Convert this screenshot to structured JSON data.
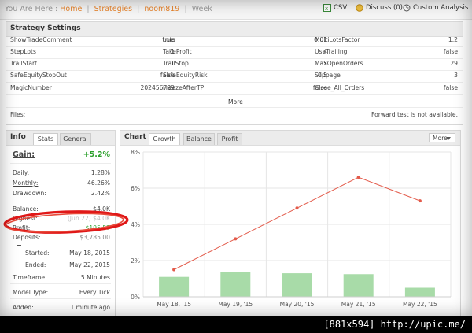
{
  "breadcrumb": {
    "prefix": "You Are Here :",
    "home": "Home",
    "strategies": "Strategies",
    "user": "noom819",
    "current": "Week"
  },
  "toolbar": {
    "csv": "CSV",
    "discuss": "Discuss (0)",
    "custom_analysis": "Custom Analysis"
  },
  "settings": {
    "title": "Strategy Settings",
    "rows": [
      [
        {
          "label": "ShowTradeComment",
          "value": "true"
        },
        {
          "label": "Lots",
          "value": "0.01"
        },
        {
          "label": "MultiLotsFactor",
          "value": "1.2"
        }
      ],
      [
        {
          "label": "StepLots",
          "value": "1"
        },
        {
          "label": "TakeProfit",
          "value": "4"
        },
        {
          "label": "UseTrailing",
          "value": "false"
        }
      ],
      [
        {
          "label": "TrailStart",
          "value": "1"
        },
        {
          "label": "TrailStop",
          "value": "5"
        },
        {
          "label": "MaxOpenOrders",
          "value": "29"
        }
      ],
      [
        {
          "label": "SafeEquityStopOut",
          "value": "false"
        },
        {
          "label": "SafeEquityRisk",
          "value": "0.5"
        },
        {
          "label": "Slippage",
          "value": "3"
        }
      ],
      [
        {
          "label": "MagicNumber",
          "value": "202456789"
        },
        {
          "label": "FreezeAfterTP",
          "value": "false"
        },
        {
          "label": "Close_All_Orders",
          "value": "false"
        }
      ]
    ],
    "more": "More",
    "files_label": "Files:",
    "files_note": "Forward test is not available."
  },
  "info": {
    "title": "Info",
    "tabs": [
      "Stats",
      "General"
    ],
    "gain_label": "Gain:",
    "gain_value": "+5.2%",
    "daily_label": "Daily:",
    "daily": "1.28%",
    "monthly_label": "Monthly:",
    "monthly": "46.26%",
    "drawdown_label": "Drawdown:",
    "drawdown": "2.42%",
    "balance_label": "Balance:",
    "balance": "$4.0K",
    "highest_label": "Highest:",
    "highest": "(Jun 22) $4.0K",
    "profit_label": "Profit:",
    "profit": "$195.57",
    "deposits_label": "Deposits:",
    "deposits": "$3,785.00",
    "started_label": "Started:",
    "started": "May 18, 2015",
    "ended_label": "Ended:",
    "ended": "May 22, 2015",
    "timeframe_label": "Timeframe:",
    "timeframe": "5 Minutes",
    "model_label": "Model Type:",
    "model": "Every Tick",
    "added_label": "Added:",
    "added": "1 minute ago"
  },
  "chart_panel": {
    "title": "Chart",
    "tabs": [
      "Growth",
      "Balance",
      "Profit"
    ],
    "more": "More"
  },
  "chart_data": {
    "type": "bar",
    "categories": [
      "May 18, '15",
      "May 19, '15",
      "May 20, '15",
      "May 21, '15",
      "May 22, '15"
    ],
    "series": [
      {
        "values": [
          1.1,
          1.35,
          1.3,
          1.25,
          0.5
        ],
        "color": "#a8dba8"
      },
      {
        "values": [
          1.5,
          3.2,
          4.9,
          6.6,
          5.3
        ],
        "color": "#e35a4a"
      }
    ],
    "y_ticks": [
      "0%",
      "2%",
      "4%",
      "6%",
      "8%"
    ],
    "ylim": [
      0,
      8
    ],
    "grid": true
  },
  "watermark": "[881x594] http://upic.me/"
}
